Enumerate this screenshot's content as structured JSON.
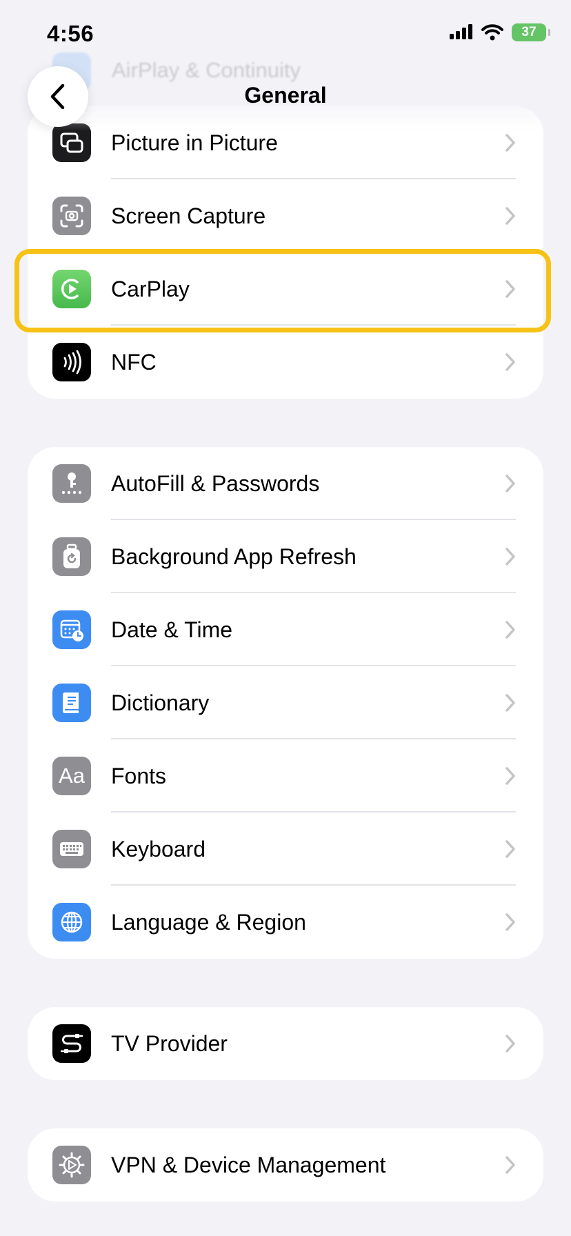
{
  "status": {
    "time": "4:56",
    "battery": "37"
  },
  "nav": {
    "title": "General",
    "background_item": "AirPlay & Continuity"
  },
  "group1": [
    {
      "label": "Picture in Picture"
    },
    {
      "label": "Screen Capture"
    },
    {
      "label": "CarPlay"
    },
    {
      "label": "NFC"
    }
  ],
  "group2": [
    {
      "label": "AutoFill & Passwords"
    },
    {
      "label": "Background App Refresh"
    },
    {
      "label": "Date & Time"
    },
    {
      "label": "Dictionary"
    },
    {
      "label": "Fonts",
      "icon_text": "Aa"
    },
    {
      "label": "Keyboard"
    },
    {
      "label": "Language & Region"
    }
  ],
  "group3": [
    {
      "label": "TV Provider"
    }
  ],
  "group4": [
    {
      "label": "VPN & Device Management"
    }
  ],
  "colors": {
    "background": "#f2f2f7",
    "highlight": "#f6c215",
    "carplay": "#5ac85a",
    "blue": "#3c8cf2",
    "gray": "#8e8e93",
    "dark": "#1c1c1e"
  }
}
